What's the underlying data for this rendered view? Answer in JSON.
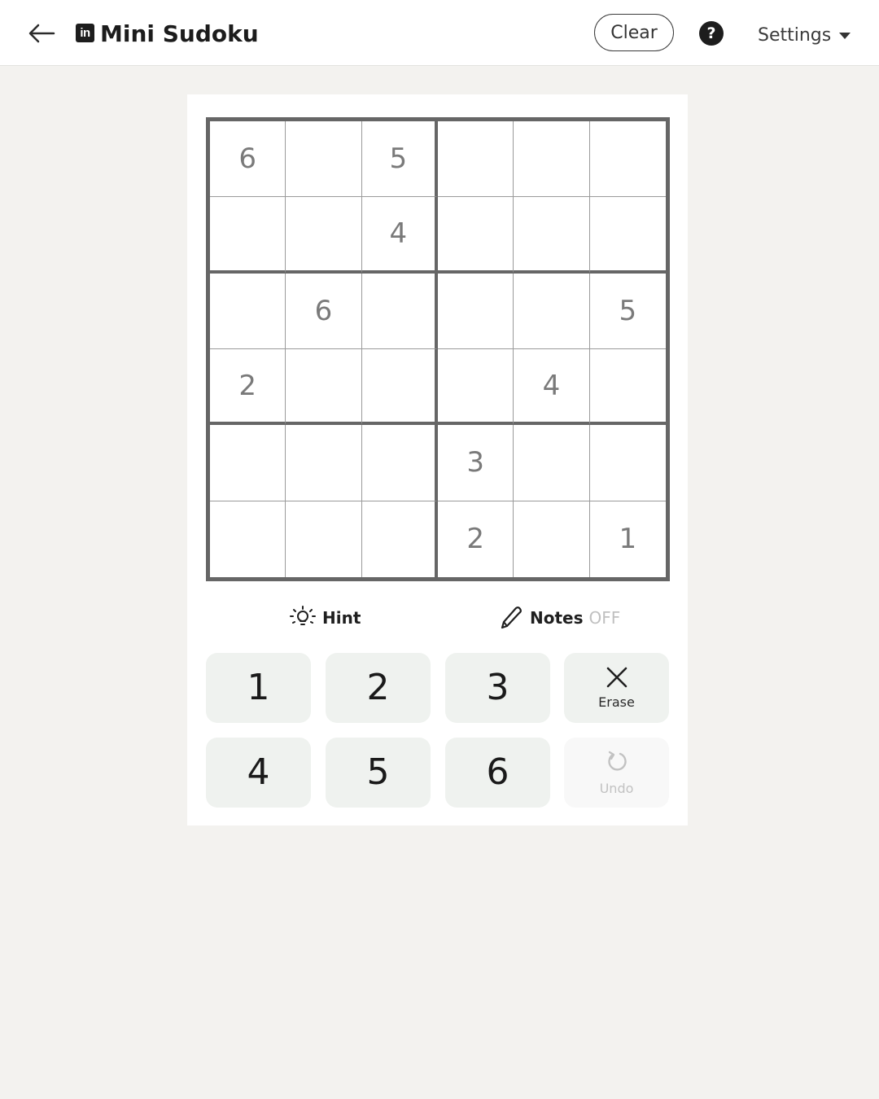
{
  "header": {
    "logo_text": "in",
    "title": "Mini Sudoku",
    "clear_label": "Clear",
    "help_label": "?",
    "settings_label": "Settings",
    "icons": {
      "back": "back-arrow-icon",
      "help": "help-icon",
      "settings_caret": "caret-down-icon"
    }
  },
  "board": {
    "size": 6,
    "cells": [
      [
        "6",
        "",
        "5",
        "",
        "",
        ""
      ],
      [
        "",
        "",
        "4",
        "",
        "",
        ""
      ],
      [
        "",
        "6",
        "",
        "",
        "",
        "5"
      ],
      [
        "2",
        "",
        "",
        "",
        "4",
        ""
      ],
      [
        "",
        "",
        "",
        "3",
        "",
        ""
      ],
      [
        "",
        "",
        "",
        "2",
        "",
        "1"
      ]
    ]
  },
  "tools": {
    "hint_label": "Hint",
    "notes_label": "Notes",
    "notes_state": "OFF"
  },
  "keypad": {
    "numbers": [
      "1",
      "2",
      "3",
      "4",
      "5",
      "6"
    ],
    "erase_label": "Erase",
    "undo_label": "Undo"
  },
  "colors": {
    "background": "#f3f2ef",
    "given_digit": "#7a7a7a",
    "board_border": "#666666",
    "key_background": "#eff2ef"
  }
}
